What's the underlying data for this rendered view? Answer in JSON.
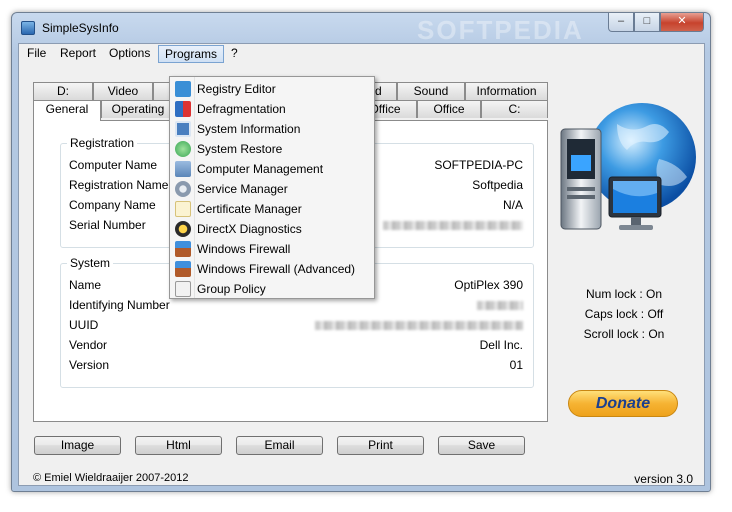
{
  "window": {
    "title": "SimpleSysInfo",
    "controls": {
      "minimize": "–",
      "maximize": "□",
      "close": "✕"
    },
    "watermark": "SOFTPEDIA"
  },
  "menubar": {
    "file": "File",
    "report": "Report",
    "options": "Options",
    "programs": "Programs",
    "help": "?"
  },
  "tabs": {
    "back_row": [
      "D:",
      "Video",
      "",
      "nd",
      "Sound",
      "Information"
    ],
    "front_row": [
      "General",
      "Operating",
      "Office",
      "Office",
      "C:"
    ]
  },
  "registration": {
    "title": "Registration",
    "rows": [
      {
        "label": "Computer Name",
        "value": "SOFTPEDIA-PC"
      },
      {
        "label": "Registration Name",
        "value": "Softpedia"
      },
      {
        "label": "Company Name",
        "value": "N/A"
      },
      {
        "label": "Serial Number",
        "value": ""
      }
    ]
  },
  "system": {
    "title": "System",
    "rows": [
      {
        "label": "Name",
        "value": "OptiPlex 390"
      },
      {
        "label": "Identifying Number",
        "value": ""
      },
      {
        "label": "UUID",
        "value": ""
      },
      {
        "label": "Vendor",
        "value": "Dell Inc."
      },
      {
        "label": "Version",
        "value": "01"
      }
    ]
  },
  "programs_menu": {
    "items": [
      {
        "label": "Registry Editor",
        "icon": "registry-editor-icon",
        "color": "#3a8fd6"
      },
      {
        "label": "Defragmentation",
        "icon": "defrag-icon",
        "color": "#2f6fc2"
      },
      {
        "label": "System Information",
        "icon": "system-info-icon",
        "color": "#4a7fbf"
      },
      {
        "label": "System Restore",
        "icon": "system-restore-icon",
        "color": "#3aa655"
      },
      {
        "label": "Computer Management",
        "icon": "computer-management-icon",
        "color": "#5b86b8"
      },
      {
        "label": "Service Manager",
        "icon": "gear-icon",
        "color": "#8a9aae"
      },
      {
        "label": "Certificate Manager",
        "icon": "certificate-icon",
        "color": "#d7c27a"
      },
      {
        "label": "DirectX  Diagnostics",
        "icon": "directx-icon",
        "color": "#2b2b2b"
      },
      {
        "label": "Windows Firewall",
        "icon": "firewall-icon",
        "color": "#b05a2a"
      },
      {
        "label": "Windows Firewall (Advanced)",
        "icon": "firewall-advanced-icon",
        "color": "#b05a2a"
      },
      {
        "label": "Group Policy",
        "icon": "group-policy-icon",
        "color": "#f2f2f2"
      }
    ]
  },
  "locks": {
    "num": "Num lock : On",
    "caps": "Caps lock : Off",
    "scroll": "Scroll lock : On"
  },
  "donate_label": "Donate",
  "buttons": {
    "image": "Image",
    "html": "Html",
    "email": "Email",
    "print": "Print",
    "save": "Save"
  },
  "footer": {
    "copyright": "© Emiel Wieldraaijer 2007-2012",
    "version": "version 3.0"
  },
  "colors": {
    "accent": "#1b3f8f",
    "donate": "#f6b333",
    "frame": "#b4c9e3"
  }
}
